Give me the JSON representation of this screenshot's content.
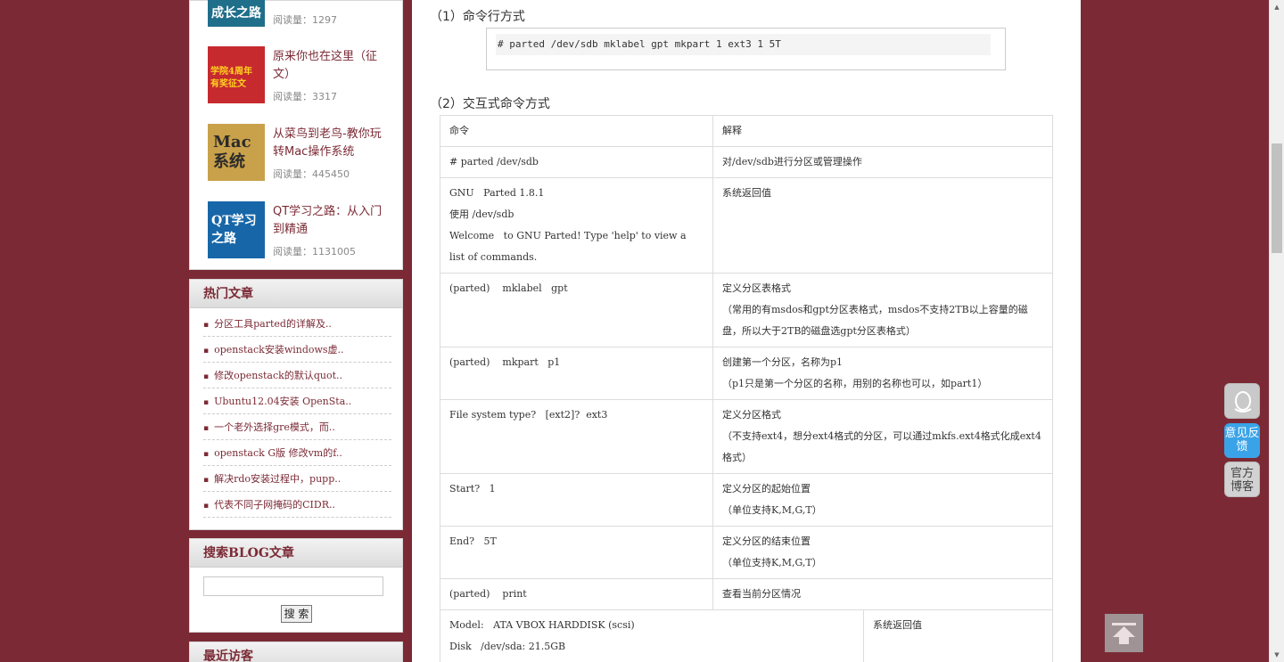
{
  "sidebar": {
    "reading_list": [
      {
        "thumb_text": "成长之路",
        "title": "",
        "count": "阅读量：1297"
      },
      {
        "thumb_text": "学院4周年 有奖征文",
        "title": "原来你也在这里（征文）",
        "count": "阅读量：3317"
      },
      {
        "thumb_text": "Mac系统",
        "title": "从菜鸟到老鸟-教你玩转Mac操作系统",
        "count": "阅读量：445450"
      },
      {
        "thumb_text": "QT学习之路",
        "title": "QT学习之路：从入门到精通",
        "count": "阅读量：1131005"
      }
    ],
    "hot": {
      "heading": "热门文章",
      "items": [
        "分区工具parted的详解及..",
        "openstack安装windows虚..",
        "修改openstack的默认quot..",
        "Ubuntu12.04安装 OpenSta..",
        "一个老外选择gre模式，而..",
        "openstack G版 修改vm的f..",
        "解决rdo安装过程中，pupp..",
        "代表不同子网掩码的CIDR.."
      ]
    },
    "search": {
      "heading": "搜索BLOG文章",
      "placeholder": "",
      "button": "搜 索"
    },
    "recent": {
      "heading": "最近访客"
    }
  },
  "main": {
    "section1": "（1）命令行方式",
    "code": "# parted /dev/sdb mklabel gpt mkpart 1 ext3 1 5T",
    "section2": "（2）交互式命令方式",
    "table": {
      "header": [
        "命令",
        "解释"
      ],
      "rows": [
        [
          "# parted /dev/sdb",
          "对/dev/sdb进行分区或管理操作"
        ],
        [
          "GNU   Parted 1.8.1\n使用 /dev/sdb\nWelcome   to GNU Parted! Type 'help' to view a list of commands.",
          "系统返回值"
        ],
        [
          "(parted)    mklabel   gpt",
          "定义分区表格式\n（常用的有msdos和gpt分区表格式，msdos不支持2TB以上容量的磁盘，所以大于2TB的磁盘选gpt分区表格式）"
        ],
        [
          "(parted)    mkpart   p1",
          "创建第一个分区，名称为p1\n（p1只是第一个分区的名称，用别的名称也可以，如part1）"
        ],
        [
          "File system type?   [ext2]?  ext3",
          "定义分区格式\n（不支持ext4，想分ext4格式的分区，可以通过mkfs.ext4格式化成ext4格式）"
        ],
        [
          "Start?   1",
          "定义分区的起始位置\n（单位支持K,M,G,T）"
        ],
        [
          "End?   5T",
          "定义分区的结束位置\n（单位支持K,M,G,T）"
        ],
        [
          "(parted)    print",
          "查看当前分区情况"
        ],
        [
          "Model:   ATA VBOX HARDDISK (scsi)\nDisk   /dev/sda: 21.5GB",
          "系统返回值"
        ]
      ]
    }
  },
  "widgets": {
    "qq_icon": "qq-penguin-icon",
    "feedback": "意见反馈",
    "blog": "官方博客",
    "back_to_top": "back-to-top-icon"
  }
}
